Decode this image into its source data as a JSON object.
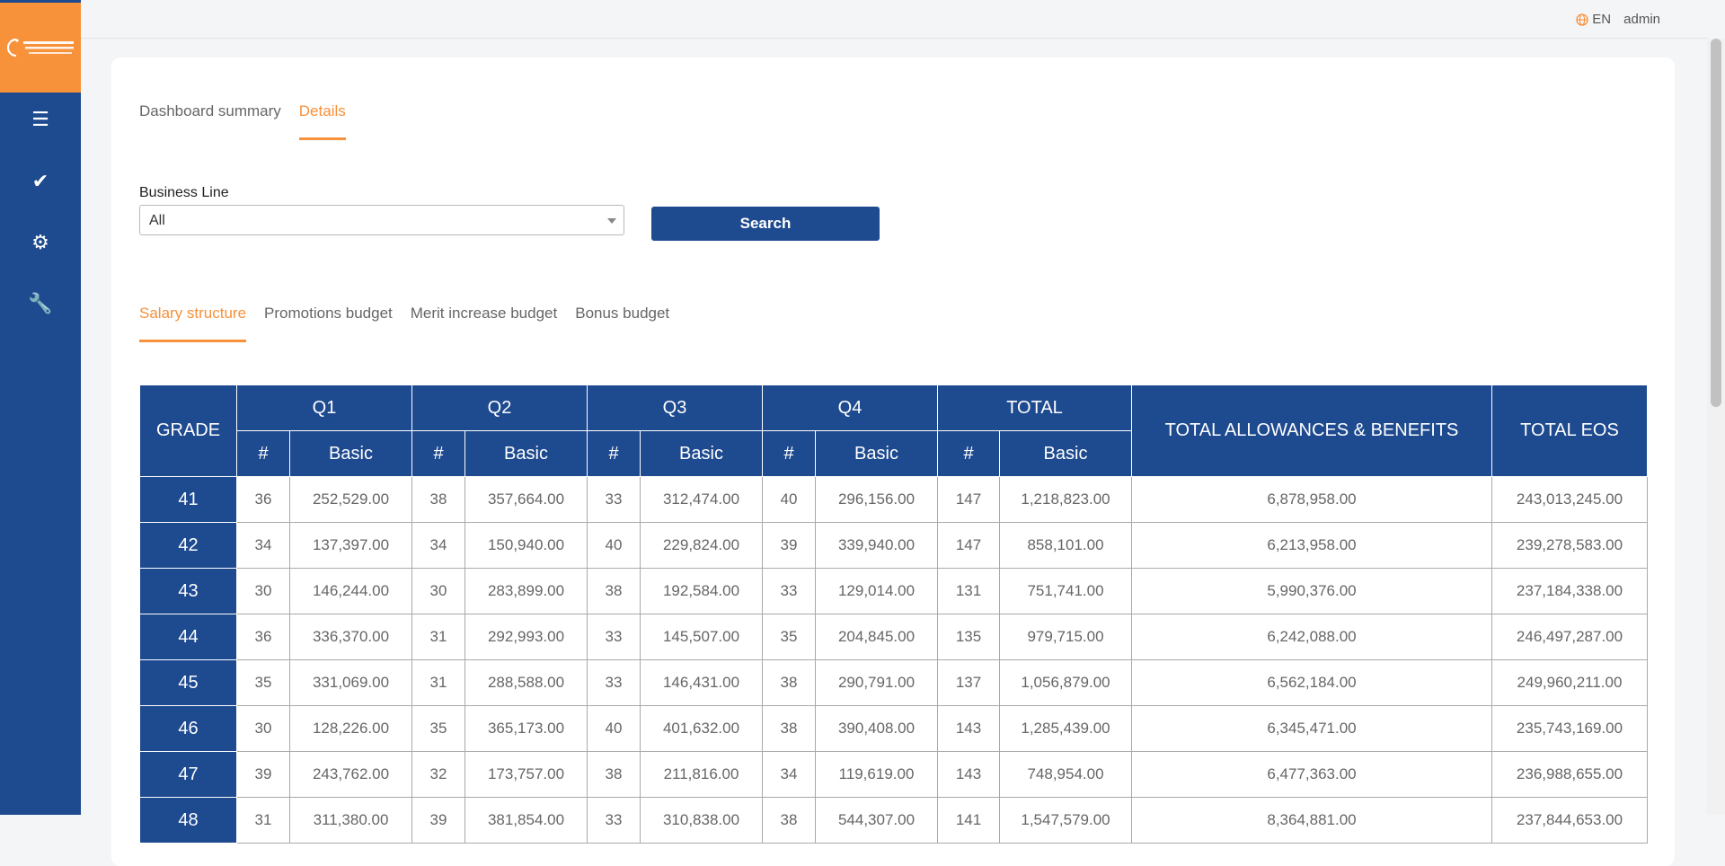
{
  "sidebar": {
    "logo_alt": "Saudi Electricity Company",
    "items": [
      {
        "icon": "list-icon",
        "glyph": "☰"
      },
      {
        "icon": "check-icon",
        "glyph": "✔"
      },
      {
        "icon": "gear-icon",
        "glyph": "⚙"
      },
      {
        "icon": "wrench-icon",
        "glyph": "🔧"
      }
    ]
  },
  "topbar": {
    "language": "EN",
    "user": "admin"
  },
  "main_tabs": [
    {
      "label": "Dashboard summary",
      "active": false
    },
    {
      "label": "Details",
      "active": true
    }
  ],
  "filter": {
    "business_line_label": "Business Line",
    "business_line_value": "All",
    "search_label": "Search"
  },
  "sub_tabs": [
    {
      "label": "Salary structure",
      "active": true
    },
    {
      "label": "Promotions budget",
      "active": false
    },
    {
      "label": "Merit increase budget",
      "active": false
    },
    {
      "label": "Bonus budget",
      "active": false
    }
  ],
  "table": {
    "grade_header": "GRADE",
    "quarter_headers": [
      "Q1",
      "Q2",
      "Q3",
      "Q4",
      "TOTAL"
    ],
    "count_header": "#",
    "basic_header": "Basic",
    "allowances_header": "TOTAL ALLOWANCES & BENEFITS",
    "eos_header": "TOTAL EOS",
    "rows": [
      {
        "grade": "41",
        "q1n": "36",
        "q1b": "252,529.00",
        "q2n": "38",
        "q2b": "357,664.00",
        "q3n": "33",
        "q3b": "312,474.00",
        "q4n": "40",
        "q4b": "296,156.00",
        "tn": "147",
        "tb": "1,218,823.00",
        "allow": "6,878,958.00",
        "eos": "243,013,245.00"
      },
      {
        "grade": "42",
        "q1n": "34",
        "q1b": "137,397.00",
        "q2n": "34",
        "q2b": "150,940.00",
        "q3n": "40",
        "q3b": "229,824.00",
        "q4n": "39",
        "q4b": "339,940.00",
        "tn": "147",
        "tb": "858,101.00",
        "allow": "6,213,958.00",
        "eos": "239,278,583.00"
      },
      {
        "grade": "43",
        "q1n": "30",
        "q1b": "146,244.00",
        "q2n": "30",
        "q2b": "283,899.00",
        "q3n": "38",
        "q3b": "192,584.00",
        "q4n": "33",
        "q4b": "129,014.00",
        "tn": "131",
        "tb": "751,741.00",
        "allow": "5,990,376.00",
        "eos": "237,184,338.00"
      },
      {
        "grade": "44",
        "q1n": "36",
        "q1b": "336,370.00",
        "q2n": "31",
        "q2b": "292,993.00",
        "q3n": "33",
        "q3b": "145,507.00",
        "q4n": "35",
        "q4b": "204,845.00",
        "tn": "135",
        "tb": "979,715.00",
        "allow": "6,242,088.00",
        "eos": "246,497,287.00"
      },
      {
        "grade": "45",
        "q1n": "35",
        "q1b": "331,069.00",
        "q2n": "31",
        "q2b": "288,588.00",
        "q3n": "33",
        "q3b": "146,431.00",
        "q4n": "38",
        "q4b": "290,791.00",
        "tn": "137",
        "tb": "1,056,879.00",
        "allow": "6,562,184.00",
        "eos": "249,960,211.00"
      },
      {
        "grade": "46",
        "q1n": "30",
        "q1b": "128,226.00",
        "q2n": "35",
        "q2b": "365,173.00",
        "q3n": "40",
        "q3b": "401,632.00",
        "q4n": "38",
        "q4b": "390,408.00",
        "tn": "143",
        "tb": "1,285,439.00",
        "allow": "6,345,471.00",
        "eos": "235,743,169.00"
      },
      {
        "grade": "47",
        "q1n": "39",
        "q1b": "243,762.00",
        "q2n": "32",
        "q2b": "173,757.00",
        "q3n": "38",
        "q3b": "211,816.00",
        "q4n": "34",
        "q4b": "119,619.00",
        "tn": "143",
        "tb": "748,954.00",
        "allow": "6,477,363.00",
        "eos": "236,988,655.00"
      },
      {
        "grade": "48",
        "q1n": "31",
        "q1b": "311,380.00",
        "q2n": "39",
        "q2b": "381,854.00",
        "q3n": "33",
        "q3b": "310,838.00",
        "q4n": "38",
        "q4b": "544,307.00",
        "tn": "141",
        "tb": "1,547,579.00",
        "allow": "8,364,881.00",
        "eos": "237,844,653.00"
      }
    ]
  },
  "colors": {
    "brand_blue": "#1e4a8f",
    "brand_orange": "#f7913a"
  }
}
